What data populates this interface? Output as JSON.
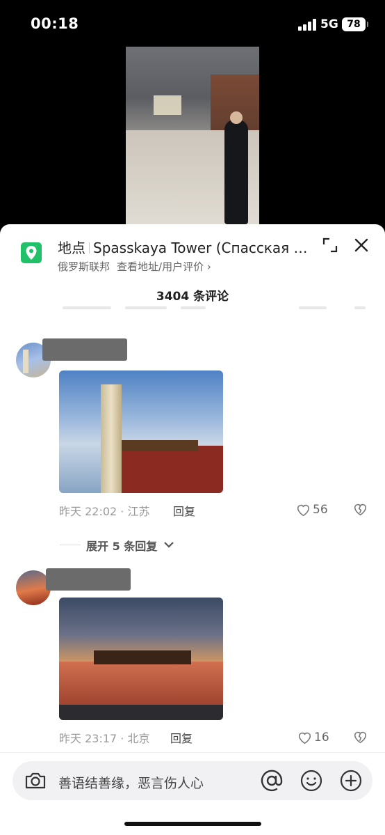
{
  "status_bar": {
    "time": "00:18",
    "network": "5G",
    "battery": "78"
  },
  "location": {
    "label": "地点",
    "name": "Spasskaya Tower (Спасская башня)",
    "country": "俄罗斯联邦",
    "link_text": "查看地址/用户评价 ›"
  },
  "comments_header": {
    "count_text": "3404 条评论"
  },
  "comments": [
    {
      "time_location": "昨天 22:02 · 江苏",
      "reply_label": "回复",
      "likes": "56"
    },
    {
      "time_location": "昨天 23:17 · 北京",
      "reply_label": "回复",
      "likes": "16"
    }
  ],
  "expand_replies": {
    "label": "展开 5 条回复"
  },
  "input_bar": {
    "placeholder": "善语结善缘，恶言伤人心"
  },
  "colors": {
    "location_icon": "#21c16a"
  }
}
